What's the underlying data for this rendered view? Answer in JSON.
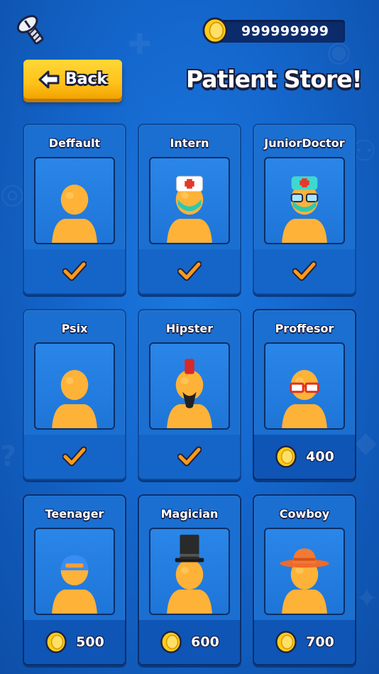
{
  "header": {
    "coin_balance": "999999999",
    "back_label": "Back",
    "title": "Patient Store!"
  },
  "colors": {
    "background": "#1466cc",
    "card": "#1a6fd0",
    "accent_yellow": "#ffc21a",
    "coin": "#ffcc1a",
    "check": "#ff9a1a",
    "skin": "#ffb238"
  },
  "items": [
    {
      "name": "Deffault",
      "owned": true,
      "accessory": "none"
    },
    {
      "name": "Intern",
      "owned": true,
      "accessory": "nurse-cap-mask"
    },
    {
      "name": "JuniorDoctor",
      "owned": true,
      "accessory": "surgical-cap-mask-glasses"
    },
    {
      "name": "Psix",
      "owned": true,
      "accessory": "none"
    },
    {
      "name": "Hipster",
      "owned": true,
      "accessory": "mohawk-beard"
    },
    {
      "name": "Proffesor",
      "owned": false,
      "price": "400",
      "accessory": "red-glasses"
    },
    {
      "name": "Teenager",
      "owned": false,
      "price": "500",
      "accessory": "blue-cap"
    },
    {
      "name": "Magician",
      "owned": false,
      "price": "600",
      "accessory": "top-hat"
    },
    {
      "name": "Cowboy",
      "owned": false,
      "price": "700",
      "accessory": "cowboy-hat"
    }
  ]
}
